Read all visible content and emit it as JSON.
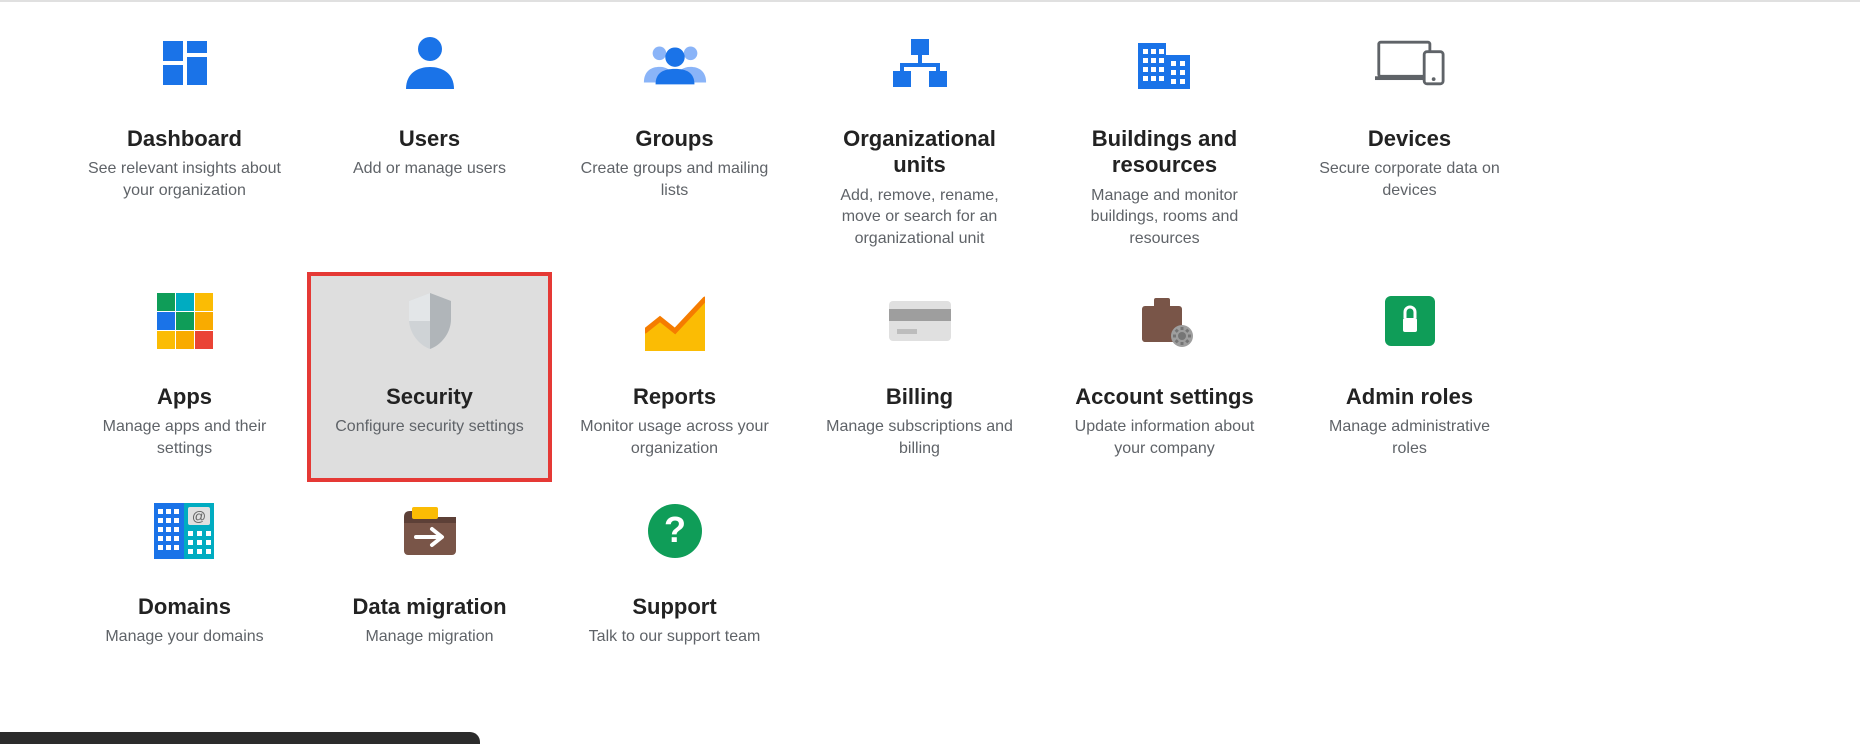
{
  "tiles": [
    {
      "id": "dashboard",
      "title": "Dashboard",
      "desc": "See relevant insights about your organization",
      "highlight": false
    },
    {
      "id": "users",
      "title": "Users",
      "desc": "Add or manage users",
      "highlight": false
    },
    {
      "id": "groups",
      "title": "Groups",
      "desc": "Create groups and mailing lists",
      "highlight": false
    },
    {
      "id": "org-units",
      "title": "Organizational units",
      "desc": "Add, remove, rename, move or search for an organizational unit",
      "highlight": false
    },
    {
      "id": "buildings",
      "title": "Buildings and resources",
      "desc": "Manage and monitor buildings, rooms and resources",
      "highlight": false
    },
    {
      "id": "devices",
      "title": "Devices",
      "desc": "Secure corporate data on devices",
      "highlight": false
    },
    {
      "id": "apps",
      "title": "Apps",
      "desc": "Manage apps and their settings",
      "highlight": false
    },
    {
      "id": "security",
      "title": "Security",
      "desc": "Configure security settings",
      "highlight": true
    },
    {
      "id": "reports",
      "title": "Reports",
      "desc": "Monitor usage across your organization",
      "highlight": false
    },
    {
      "id": "billing",
      "title": "Billing",
      "desc": "Manage subscriptions and billing",
      "highlight": false
    },
    {
      "id": "account",
      "title": "Account settings",
      "desc": "Update information about your company",
      "highlight": false
    },
    {
      "id": "admin-roles",
      "title": "Admin roles",
      "desc": "Manage administrative roles",
      "highlight": false
    },
    {
      "id": "domains",
      "title": "Domains",
      "desc": "Manage your domains",
      "highlight": false
    },
    {
      "id": "data-migration",
      "title": "Data migration",
      "desc": "Manage migration",
      "highlight": false
    },
    {
      "id": "support",
      "title": "Support",
      "desc": "Talk to our support team",
      "highlight": false
    }
  ],
  "colors": {
    "blue": "#1a73e8",
    "lightBlue": "#8ab4f8",
    "green": "#0f9d58",
    "orange": "#f9ab00",
    "yellow": "#fbbc04",
    "red": "#ea4335",
    "teal": "#00acc1",
    "brown": "#795548",
    "grey": "#9e9e9e"
  }
}
